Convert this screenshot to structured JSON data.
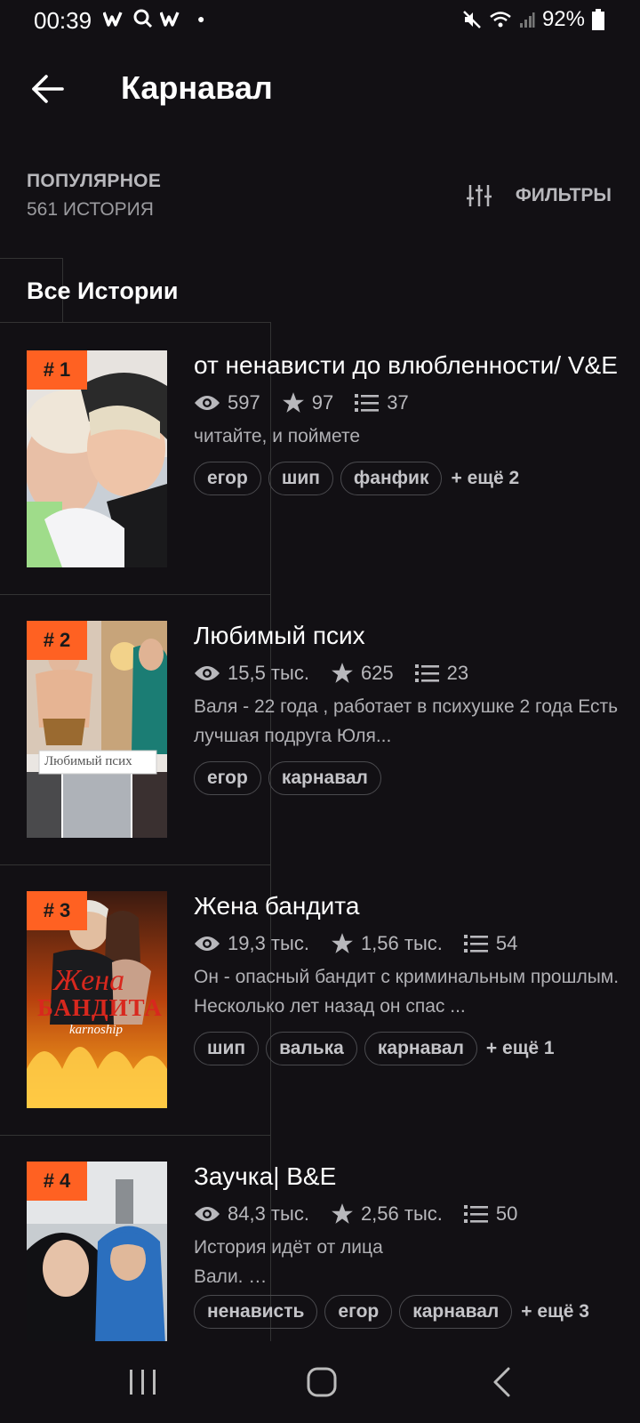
{
  "status_bar": {
    "time": "00:39",
    "battery": "92%"
  },
  "header": {
    "title": "Карнавал"
  },
  "subheader": {
    "category": "ПОПУЛЯРНОЕ",
    "count": "561 ИСТОРИЯ",
    "filters_label": "ФИЛЬТРЫ"
  },
  "section_title": "Все Истории",
  "stories": [
    {
      "rank": "# 1",
      "title": "от ненависти до влюбленности/ V&E",
      "views": "597",
      "votes": "97",
      "parts": "37",
      "description": "читайте, и поймете",
      "tags": [
        "егор",
        "шип",
        "фанфик"
      ],
      "more": "+ ещё 2"
    },
    {
      "rank": "# 2",
      "title": "Любимый псих",
      "views": "15,5 тыс.",
      "votes": "625",
      "parts": "23",
      "description": "Валя - 22 года , работает в психушке 2 года Есть лучшая подруга Юля...",
      "tags": [
        "егор",
        "карнавал"
      ],
      "more": "",
      "cover_text": "Любимый псих"
    },
    {
      "rank": "# 3",
      "title": "Жена бандита",
      "views": "19,3 тыс.",
      "votes": "1,56 тыс.",
      "parts": "54",
      "description": "Он - опасный бандит с криминальным прошлым. Несколько лет назад он спас ...",
      "tags": [
        "шип",
        "валька",
        "карнавал"
      ],
      "more": "+ ещё 1",
      "cover_text_1": "Жена",
      "cover_text_2": "БАНДИТА",
      "cover_author": "karnoship"
    },
    {
      "rank": "# 4",
      "title": "Заучка| B&E",
      "views": "84,3 тыс.",
      "votes": "2,56 тыс.",
      "parts": "50",
      "description": "История идёт от лица Вали. …",
      "tags": [
        "ненависть",
        "егор",
        "карнавал"
      ],
      "more": "+ ещё 3"
    }
  ]
}
